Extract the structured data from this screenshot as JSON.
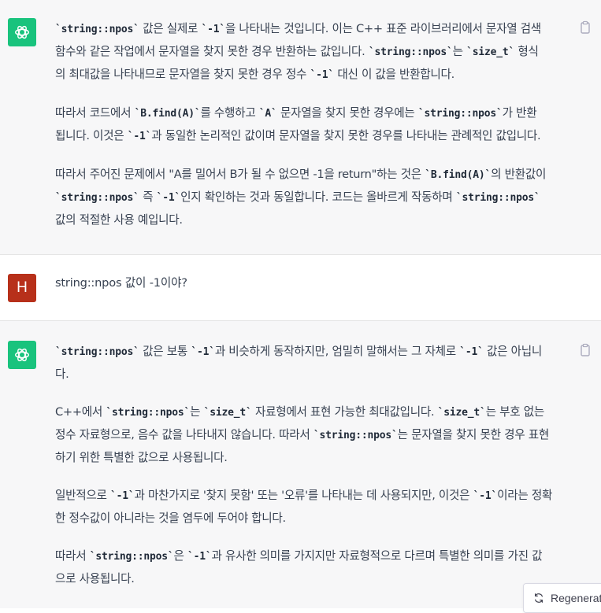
{
  "messages": [
    {
      "role": "assistant",
      "avatar_icon": "openai-logo-icon",
      "paragraphs": [
        [
          [
            {
              "c": "`string::npos`"
            },
            {
              "t": " 값은 실제로 "
            },
            {
              "c": "`-1`"
            },
            {
              "t": "을 나타내는 것입니다. 이는 C++ 표준 라이브러리에서 문자열 검색"
            }
          ],
          [
            {
              "t": "함수와 같은 작업에서 문자열을 찾지 못한 경우 반환하는 값입니다. "
            },
            {
              "c": "`string::npos`"
            },
            {
              "t": "는 "
            },
            {
              "c": "`size_t`"
            },
            {
              "t": " 형식"
            }
          ],
          [
            {
              "t": "의 최대값을 나타내므로 문자열을 찾지 못한 경우 정수 "
            },
            {
              "c": "`-1`"
            },
            {
              "t": " 대신 이 값을 반환합니다."
            }
          ]
        ],
        [
          [
            {
              "t": "따라서 코드에서 "
            },
            {
              "c": "`B.find(A)`"
            },
            {
              "t": "를 수행하고 "
            },
            {
              "c": "`A`"
            },
            {
              "t": " 문자열을 찾지 못한 경우에는 "
            },
            {
              "c": "`string::npos`"
            },
            {
              "t": "가 반환"
            }
          ],
          [
            {
              "t": "됩니다. 이것은 "
            },
            {
              "c": "`-1`"
            },
            {
              "t": "과 동일한 논리적인 값이며 문자열을 찾지 못한 경우를 나타내는 관례적인 값입니다."
            }
          ]
        ],
        [
          [
            {
              "t": "따라서 주어진 문제에서 \"A를 밀어서 B가 될 수 없으면 -1을 return\"하는 것은 "
            },
            {
              "c": "`B.find(A)`"
            },
            {
              "t": "의 반환값이"
            }
          ],
          [
            {
              "c": "`string::npos`"
            },
            {
              "t": " 즉 "
            },
            {
              "c": "`-1`"
            },
            {
              "t": "인지 확인하는 것과 동일합니다. 코드는 올바르게 작동하며 "
            },
            {
              "c": "`string::npos`"
            }
          ],
          [
            {
              "t": "값의 적절한 사용 예입니다."
            }
          ]
        ]
      ]
    },
    {
      "role": "user",
      "avatar_letter": "H",
      "text": "string::npos 값이 -1이야?"
    },
    {
      "role": "assistant",
      "avatar_icon": "openai-logo-icon",
      "paragraphs": [
        [
          [
            {
              "c": "`string::npos`"
            },
            {
              "t": " 값은 보통 "
            },
            {
              "c": "`-1`"
            },
            {
              "t": "과 비슷하게 동작하지만, 엄밀히 말해서는 그 자체로 "
            },
            {
              "c": "`-1`"
            },
            {
              "t": " 값은 아닙니"
            }
          ],
          [
            {
              "t": "다."
            }
          ]
        ],
        [
          [
            {
              "t": "C++에서 "
            },
            {
              "c": "`string::npos`"
            },
            {
              "t": "는 "
            },
            {
              "c": "`size_t`"
            },
            {
              "t": " 자료형에서 표현 가능한 최대값입니다. "
            },
            {
              "c": "`size_t`"
            },
            {
              "t": "는 부호 없는"
            }
          ],
          [
            {
              "t": "정수 자료형으로, 음수 값을 나타내지 않습니다. 따라서 "
            },
            {
              "c": "`string::npos`"
            },
            {
              "t": "는 문자열을 찾지 못한 경우 표현"
            }
          ],
          [
            {
              "t": "하기 위한 특별한 값으로 사용됩니다."
            }
          ]
        ],
        [
          [
            {
              "t": "일반적으로 "
            },
            {
              "c": "`-1`"
            },
            {
              "t": "과 마찬가지로 '찾지 못함' 또는 '오류'를 나타내는 데 사용되지만, 이것은 "
            },
            {
              "c": "`-1`"
            },
            {
              "t": "이라는 정확"
            }
          ],
          [
            {
              "t": "한 정수값이 아니라는 것을 염두에 두어야 합니다."
            }
          ]
        ],
        [
          [
            {
              "t": "따라서 "
            },
            {
              "c": "`string::npos`"
            },
            {
              "t": "은 "
            },
            {
              "c": "`-1`"
            },
            {
              "t": "과 유사한 의미를 가지지만 자료형적으로 다르며 특별한 의미를 가진 값"
            }
          ],
          [
            {
              "t": "으로 사용됩니다."
            }
          ]
        ]
      ]
    }
  ],
  "copy_icon": "clipboard-icon",
  "regenerate": {
    "icon": "refresh-icon",
    "label": "Regenerate"
  },
  "colors": {
    "assistant_bg": "#f7f7f8",
    "user_bg": "#ffffff",
    "openai_green": "#19c37d",
    "user_avatar": "#b7301a",
    "text": "#374151"
  }
}
